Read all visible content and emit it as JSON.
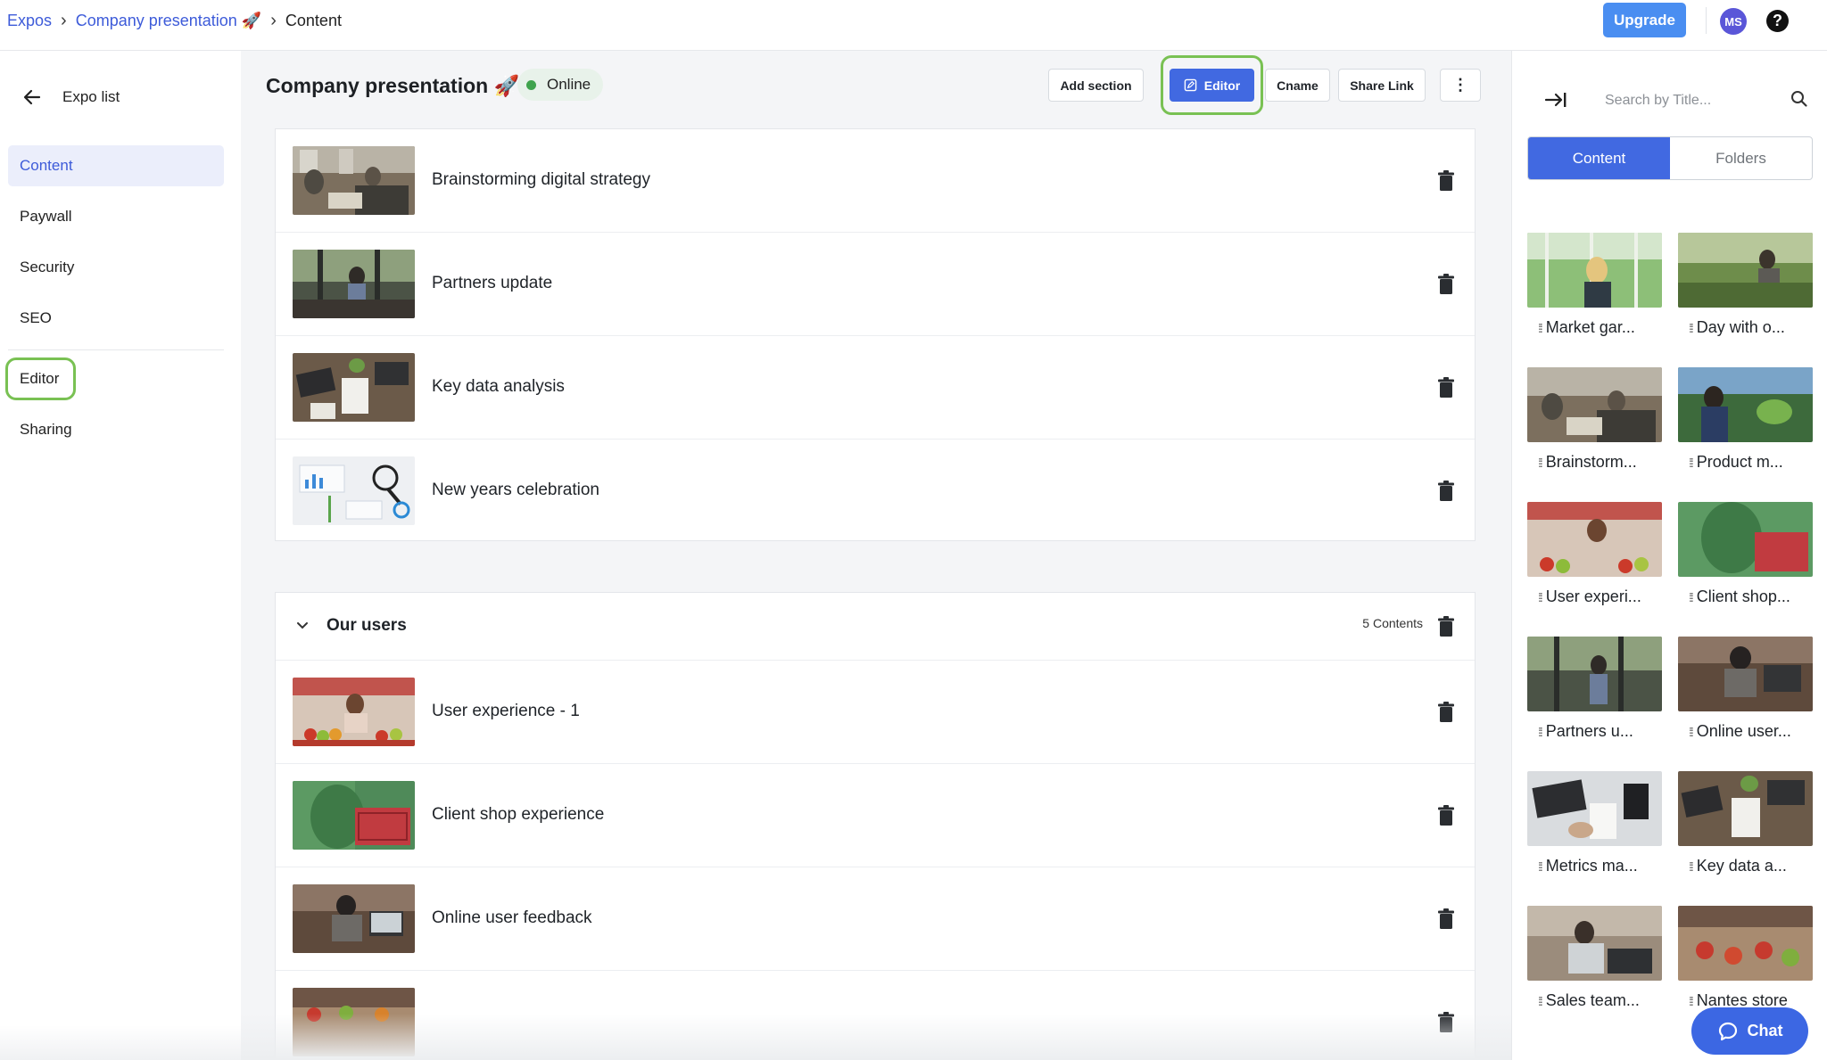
{
  "breadcrumb": {
    "expos": "Expos",
    "presentation": "Company presentation 🚀",
    "current": "Content"
  },
  "header": {
    "upgrade": "Upgrade",
    "avatar_initials": "MS",
    "help": "?"
  },
  "sidebar": {
    "back_label": "Expo list",
    "items": [
      {
        "label": "Content"
      },
      {
        "label": "Paywall"
      },
      {
        "label": "Security"
      },
      {
        "label": "SEO"
      },
      {
        "label": "Editor"
      },
      {
        "label": "Sharing"
      }
    ]
  },
  "main": {
    "title": "Company presentation 🚀",
    "status": "Online",
    "buttons": {
      "add_section": "Add section",
      "editor": "Editor",
      "cname": "Cname",
      "share_link": "Share Link",
      "more": "⋮"
    },
    "items": [
      {
        "title": "Brainstorming digital strategy"
      },
      {
        "title": "Partners update"
      },
      {
        "title": "Key data analysis"
      },
      {
        "title": "New years celebration"
      }
    ],
    "section": {
      "title": "Our users",
      "count": "5 Contents",
      "items": [
        {
          "title": "User experience - 1"
        },
        {
          "title": "Client shop experience"
        },
        {
          "title": "Online user feedback"
        }
      ]
    }
  },
  "library": {
    "search_placeholder": "Search by Title...",
    "tabs": {
      "content": "Content",
      "folders": "Folders"
    },
    "cards": [
      {
        "label": "Market gar..."
      },
      {
        "label": "Day with o..."
      },
      {
        "label": "Brainstorm..."
      },
      {
        "label": "Product m..."
      },
      {
        "label": "User experi..."
      },
      {
        "label": "Client shop..."
      },
      {
        "label": "Partners u..."
      },
      {
        "label": "Online user..."
      },
      {
        "label": "Metrics ma..."
      },
      {
        "label": "Key data a..."
      },
      {
        "label": "Sales team..."
      },
      {
        "label": "Nantes store"
      }
    ]
  },
  "chat": {
    "label": "Chat"
  },
  "colors": {
    "accent": "#4169e1",
    "highlight_ring": "#79c153",
    "online": "#3fa34d"
  }
}
